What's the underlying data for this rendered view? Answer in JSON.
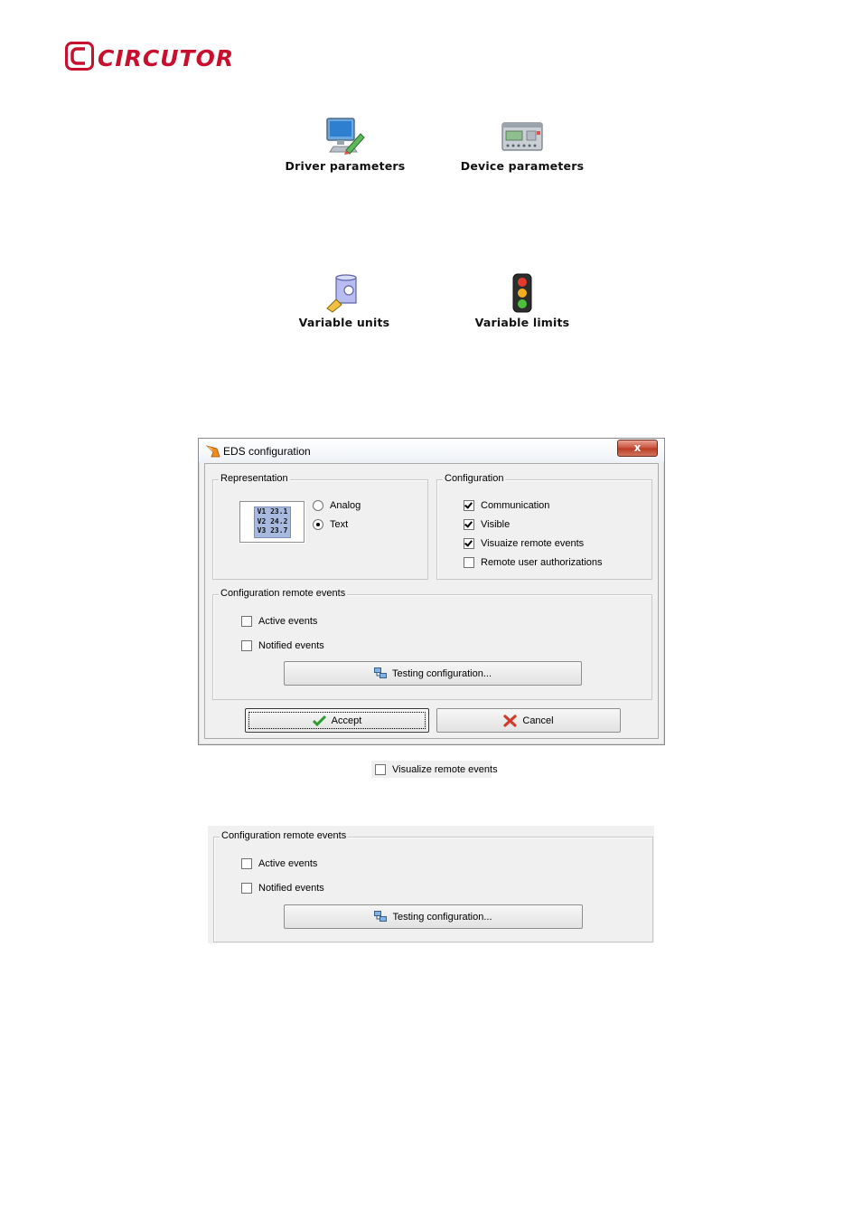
{
  "logo": {
    "text": "CIRCUTOR",
    "color": "#c8102e"
  },
  "icons": [
    {
      "label": "Driver parameters",
      "icon": "monitor-pencil-icon"
    },
    {
      "label": "Device parameters",
      "icon": "device-meter-icon"
    },
    {
      "label": "Variable units",
      "icon": "units-cylinder-icon"
    },
    {
      "label": "Variable limits",
      "icon": "traffic-light-icon"
    }
  ],
  "dialog": {
    "title": "EDS configuration",
    "close_label": "x",
    "representation": {
      "title": "Representation",
      "preview_lines": [
        "V1 23.1",
        "V2 24.2",
        "V3 23.7"
      ],
      "options": [
        {
          "label": "Analog",
          "selected": false
        },
        {
          "label": "Text",
          "selected": true
        }
      ]
    },
    "configuration": {
      "title": "Configuration",
      "items": [
        {
          "label": "Communication",
          "checked": true
        },
        {
          "label": "Visible",
          "checked": true
        },
        {
          "label": "Visuaize remote events",
          "checked": true
        },
        {
          "label": "Remote user authorizations",
          "checked": false
        }
      ]
    },
    "remote_events": {
      "title": "Configuration remote events",
      "items": [
        {
          "label": "Active events",
          "checked": false
        },
        {
          "label": "Notified events",
          "checked": false
        }
      ],
      "testing_label": "Testing configuration..."
    },
    "accept_label": "Accept",
    "cancel_label": "Cancel"
  },
  "standalone_checkbox": {
    "label": "Visualize remote events",
    "checked": false
  },
  "standalone_group": {
    "title": "Configuration remote events",
    "items": [
      {
        "label": "Active events",
        "checked": false
      },
      {
        "label": "Notified events",
        "checked": false
      }
    ],
    "testing_label": "Testing configuration..."
  }
}
